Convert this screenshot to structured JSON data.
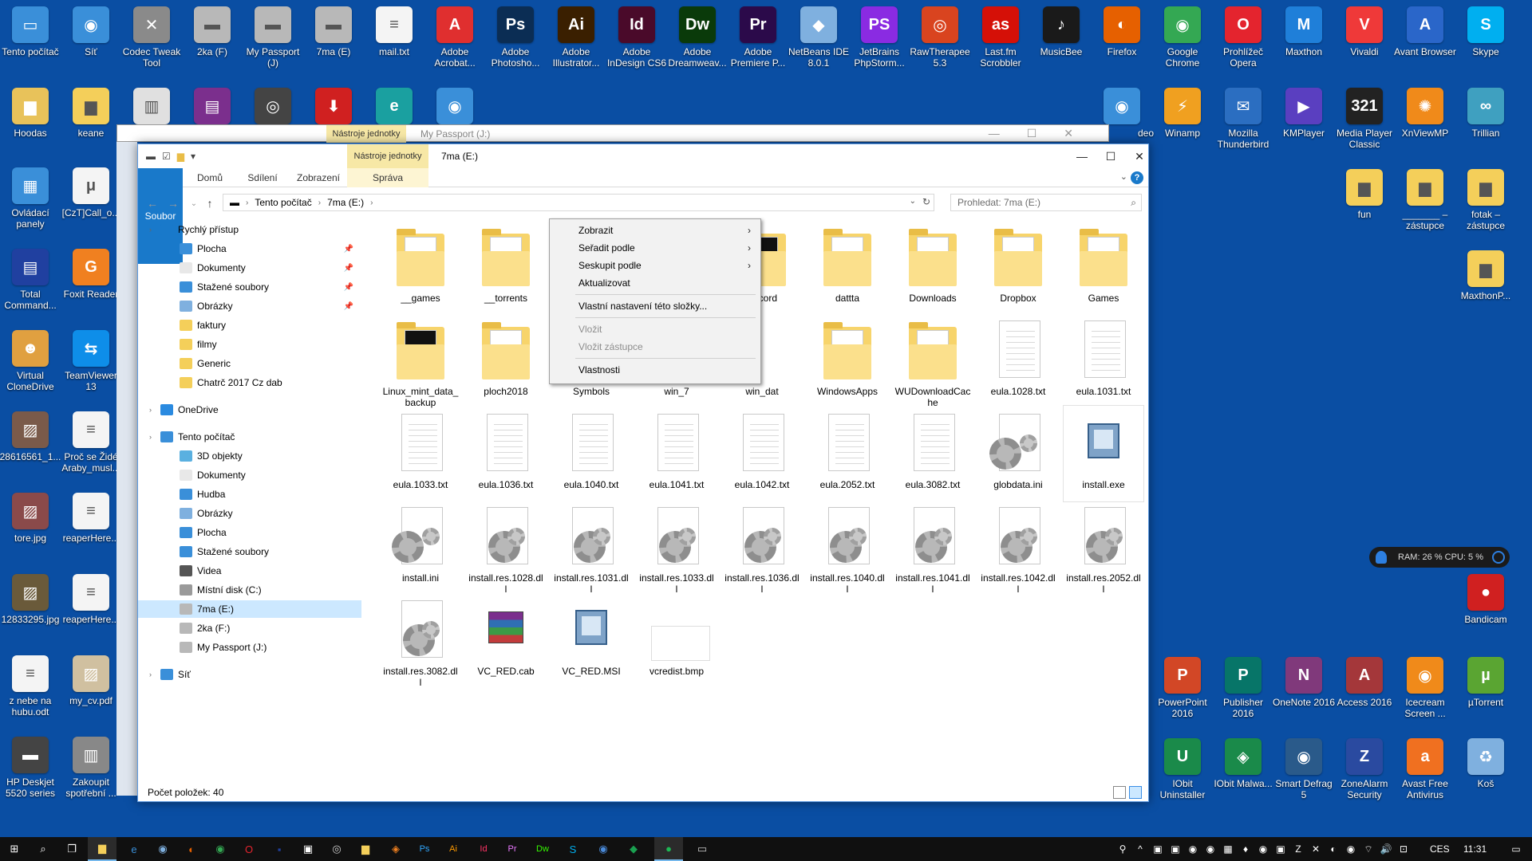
{
  "desktop": {
    "icons_top": [
      {
        "label": "Tento počítač",
        "color": "#3a8fd9",
        "glyph": "▭"
      },
      {
        "label": "Síť",
        "color": "#3a8fd9",
        "glyph": "◉"
      },
      {
        "label": "Codec Tweak Tool",
        "color": "#8a8a8a",
        "glyph": "✕"
      },
      {
        "label": "2ka (F)",
        "color": "#b8b8b8",
        "glyph": "▬"
      },
      {
        "label": "My Passport (J)",
        "color": "#b8b8b8",
        "glyph": "▬"
      },
      {
        "label": "7ma (E)",
        "color": "#b8b8b8",
        "glyph": "▬"
      },
      {
        "label": "mail.txt",
        "color": "#f4f4f4",
        "glyph": "≡"
      },
      {
        "label": "Adobe Acrobat...",
        "color": "#e02f2f",
        "glyph": "A"
      },
      {
        "label": "Adobe Photosho...",
        "color": "#0b2d54",
        "glyph": "Ps"
      },
      {
        "label": "Adobe Illustrator...",
        "color": "#3a1f00",
        "glyph": "Ai"
      },
      {
        "label": "Adobe InDesign CS6",
        "color": "#4a0a2a",
        "glyph": "Id"
      },
      {
        "label": "Adobe Dreamweav...",
        "color": "#0a3a0a",
        "glyph": "Dw"
      },
      {
        "label": "Adobe Premiere P...",
        "color": "#2b0a4a",
        "glyph": "Pr"
      },
      {
        "label": "NetBeans IDE 8.0.1",
        "color": "#7fb0df",
        "glyph": "◆"
      },
      {
        "label": "JetBrains PhpStorm...",
        "color": "#8a2be2",
        "glyph": "PS"
      },
      {
        "label": "RawTherapee 5.3",
        "color": "#d9441f",
        "glyph": "◎"
      },
      {
        "label": "Last.fm Scrobbler",
        "color": "#d51007",
        "glyph": "as"
      },
      {
        "label": "MusicBee",
        "color": "#1a1a1a",
        "glyph": "♪"
      },
      {
        "label": "Firefox",
        "color": "#e66000",
        "glyph": "◐"
      },
      {
        "label": "Google Chrome",
        "color": "#34a853",
        "glyph": "◉"
      },
      {
        "label": "Prohlížeč Opera",
        "color": "#e4242e",
        "glyph": "O"
      },
      {
        "label": "Maxthon",
        "color": "#1f7fd9",
        "glyph": "M"
      },
      {
        "label": "Vivaldi",
        "color": "#ef3939",
        "glyph": "V"
      },
      {
        "label": "Avant Browser",
        "color": "#2a66c9",
        "glyph": "A"
      },
      {
        "label": "Skype",
        "color": "#00aff0",
        "glyph": "S"
      }
    ],
    "icons_row2_left": [
      {
        "label": "Hoodas",
        "color": "#e8c25a",
        "glyph": "▆"
      },
      {
        "label": "keane",
        "color": "#f4cf5a",
        "glyph": "▆"
      }
    ],
    "icons_row2_right": [
      {
        "label": "Winamp",
        "color": "#f0a020",
        "glyph": "⚡"
      },
      {
        "label": "Mozilla Thunderbird",
        "color": "#2b6ec1",
        "glyph": "✉"
      },
      {
        "label": "KMPlayer",
        "color": "#5a3fc0",
        "glyph": "▶"
      },
      {
        "label": "Media Player Classic",
        "color": "#222222",
        "glyph": "321"
      },
      {
        "label": "XnViewMP",
        "color": "#f08a1a",
        "glyph": "✺"
      },
      {
        "label": "Trillian",
        "color": "#3fa0c0",
        "glyph": "∞"
      }
    ],
    "icons_left_col1": [
      {
        "label": "Ovládací panely",
        "color": "#3a8fd9",
        "glyph": "▦"
      },
      {
        "label": "Total Command...",
        "color": "#2040a0",
        "glyph": "▤"
      },
      {
        "label": "Virtual CloneDrive",
        "color": "#e0a040",
        "glyph": "☻"
      },
      {
        "label": "28616561_1...",
        "color": "#7a5a4a",
        "glyph": "▨"
      },
      {
        "label": "tore.jpg",
        "color": "#8a4a4a",
        "glyph": "▨"
      },
      {
        "label": "12833295.jpg",
        "color": "#6a5a3a",
        "glyph": "▨"
      },
      {
        "label": "z nebe na hubu.odt",
        "color": "#f4f4f4",
        "glyph": "≡"
      },
      {
        "label": "HP Deskjet 5520 series",
        "color": "#444444",
        "glyph": "▬"
      }
    ],
    "icons_left_col2": [
      {
        "label": "[CzT]Call_o...",
        "color": "#f4f4f4",
        "glyph": "μ"
      },
      {
        "label": "Foxit Reader",
        "color": "#f08020",
        "glyph": "G"
      },
      {
        "label": "TeamViewer 13",
        "color": "#0e8ee9",
        "glyph": "⇆"
      },
      {
        "label": "Proč se Židé Araby_musl...",
        "color": "#f4f4f4",
        "glyph": "≡"
      },
      {
        "label": "reaperHere...",
        "color": "#f4f4f4",
        "glyph": "≡"
      },
      {
        "label": "reaperHere...",
        "color": "#f4f4f4",
        "glyph": "≡"
      },
      {
        "label": "my_cv.pdf",
        "color": "#d0c0a0",
        "glyph": "▨"
      },
      {
        "label": "Zakoupit spotřební ...",
        "color": "#888888",
        "glyph": "▥"
      }
    ],
    "icons_right_mid": [
      {
        "label": "fun",
        "color": "#f4cf5a",
        "glyph": "▆"
      },
      {
        "label": "_______ – zástupce",
        "color": "#f4cf5a",
        "glyph": "▆"
      },
      {
        "label": "fotak – zástupce",
        "color": "#f4cf5a",
        "glyph": "▆"
      },
      {
        "label": "MaxthonP...",
        "color": "#f4cf5a",
        "glyph": "▆"
      }
    ],
    "bandicam": {
      "label": "Bandicam",
      "color": "#d02020",
      "glyph": "●"
    },
    "icons_bottom_right_row1": [
      {
        "label": "PowerPoint 2016",
        "color": "#d24726",
        "glyph": "P"
      },
      {
        "label": "Publisher 2016",
        "color": "#077568",
        "glyph": "P"
      },
      {
        "label": "OneNote 2016",
        "color": "#80397b",
        "glyph": "N"
      },
      {
        "label": "Access 2016",
        "color": "#a4373a",
        "glyph": "A"
      },
      {
        "label": "Icecream Screen ...",
        "color": "#f08a1a",
        "glyph": "◉"
      },
      {
        "label": "µTorrent",
        "color": "#5aa532",
        "glyph": "µ"
      }
    ],
    "icons_bottom_right_row2": [
      {
        "label": "IObit Uninstaller",
        "color": "#1a8a4a",
        "glyph": "U"
      },
      {
        "label": "IObit Malwa...",
        "color": "#1a8a4a",
        "glyph": "◈"
      },
      {
        "label": "Smart Defrag 5",
        "color": "#2a5a8a",
        "glyph": "◉"
      },
      {
        "label": "ZoneAlarm Security",
        "color": "#2a4aa0",
        "glyph": "Z"
      },
      {
        "label": "Avast Free Antivirus",
        "color": "#f07020",
        "glyph": "a"
      },
      {
        "label": "Koš",
        "color": "#7fb0df",
        "glyph": "♻"
      }
    ],
    "icons_misc_row2": [
      {
        "color": "#e0e0e0",
        "glyph": "▥"
      },
      {
        "color": "#7b2f8d",
        "glyph": "▤"
      },
      {
        "color": "#444444",
        "glyph": "◎"
      },
      {
        "color": "#d02020",
        "glyph": "⬇"
      },
      {
        "color": "#1aa0a0",
        "glyph": "e"
      },
      {
        "color": "#3a8fd9",
        "glyph": "◉"
      }
    ],
    "partial_label": "deo"
  },
  "back_window": {
    "title": "My Passport (J:)",
    "tools_tab": "Nástroje jednotky"
  },
  "window": {
    "title": "7ma (E:)",
    "tools_tab": "Nástroje jednotky",
    "controls": {
      "minimize": "—",
      "maximize": "☐",
      "close": "✕"
    },
    "ribbon_tabs": [
      "Soubor",
      "Domů",
      "Sdílení",
      "Zobrazení",
      "Správa"
    ],
    "address": {
      "root": "Tento počítač",
      "current": "7ma (E:)"
    },
    "search_placeholder": "Prohledat: 7ma (E:)",
    "status": "Počet položek: 40"
  },
  "navigation": {
    "quick_access": "Rychlý přístup",
    "quick_items": [
      {
        "label": "Plocha",
        "color": "#3a8fd9",
        "pinned": true
      },
      {
        "label": "Dokumenty",
        "color": "#e8e8e8",
        "pinned": true
      },
      {
        "label": "Stažené soubory",
        "color": "#3a8fd9",
        "pinned": true
      },
      {
        "label": "Obrázky",
        "color": "#7fb0df",
        "pinned": true
      },
      {
        "label": "faktury",
        "color": "#f4cf5a",
        "pinned": false
      },
      {
        "label": "filmy",
        "color": "#f4cf5a",
        "pinned": false
      },
      {
        "label": "Generic",
        "color": "#f4cf5a",
        "pinned": false
      },
      {
        "label": "Chatrč 2017 Cz dab",
        "color": "#f4cf5a",
        "pinned": false
      }
    ],
    "onedrive": "OneDrive",
    "this_pc": "Tento počítač",
    "pc_items": [
      {
        "label": "3D objekty",
        "color": "#5ab0e0"
      },
      {
        "label": "Dokumenty",
        "color": "#e8e8e8"
      },
      {
        "label": "Hudba",
        "color": "#3a8fd9"
      },
      {
        "label": "Obrázky",
        "color": "#7fb0df"
      },
      {
        "label": "Plocha",
        "color": "#3a8fd9"
      },
      {
        "label": "Stažené soubory",
        "color": "#3a8fd9"
      },
      {
        "label": "Videa",
        "color": "#555555"
      },
      {
        "label": "Místní disk (C:)",
        "color": "#9a9a9a"
      },
      {
        "label": "7ma (E:)",
        "color": "#b8b8b8",
        "selected": true
      },
      {
        "label": "2ka (F:)",
        "color": "#b8b8b8"
      },
      {
        "label": "My Passport (J:)",
        "color": "#b8b8b8"
      }
    ],
    "network": "Síť"
  },
  "files": [
    {
      "name": "__games",
      "type": "folder"
    },
    {
      "name": "__torrents",
      "type": "folder"
    },
    {
      "name": "",
      "type": "hidden"
    },
    {
      "name": "",
      "type": "hidden"
    },
    {
      "name": "-record",
      "type": "folder-dark"
    },
    {
      "name": "dattta",
      "type": "folder"
    },
    {
      "name": "Downloads",
      "type": "folder"
    },
    {
      "name": "Dropbox",
      "type": "folder"
    },
    {
      "name": "Games",
      "type": "folder"
    },
    {
      "name": "Linux_mint_data_backup",
      "type": "folder-dark"
    },
    {
      "name": "ploch2018",
      "type": "folder"
    },
    {
      "name": "Symbols",
      "type": "hidden"
    },
    {
      "name": "win_7",
      "type": "hidden"
    },
    {
      "name": "win_dat",
      "type": "hidden"
    },
    {
      "name": "WindowsApps",
      "type": "folder"
    },
    {
      "name": "WUDownloadCache",
      "type": "folder"
    },
    {
      "name": "eula.1028.txt",
      "type": "doc"
    },
    {
      "name": "eula.1031.txt",
      "type": "doc"
    },
    {
      "name": "eula.1033.txt",
      "type": "doc"
    },
    {
      "name": "eula.1036.txt",
      "type": "doc"
    },
    {
      "name": "eula.1040.txt",
      "type": "doc"
    },
    {
      "name": "eula.1041.txt",
      "type": "doc"
    },
    {
      "name": "eula.1042.txt",
      "type": "doc"
    },
    {
      "name": "eula.2052.txt",
      "type": "doc"
    },
    {
      "name": "eula.3082.txt",
      "type": "doc"
    },
    {
      "name": "globdata.ini",
      "type": "ini"
    },
    {
      "name": "install.exe",
      "type": "exe"
    },
    {
      "name": "install.ini",
      "type": "ini"
    },
    {
      "name": "install.res.1028.dll",
      "type": "dll"
    },
    {
      "name": "install.res.1031.dll",
      "type": "dll"
    },
    {
      "name": "install.res.1033.dll",
      "type": "dll"
    },
    {
      "name": "install.res.1036.dll",
      "type": "dll"
    },
    {
      "name": "install.res.1040.dll",
      "type": "dll"
    },
    {
      "name": "install.res.1041.dll",
      "type": "dll"
    },
    {
      "name": "install.res.1042.dll",
      "type": "dll"
    },
    {
      "name": "install.res.2052.dll",
      "type": "dll"
    },
    {
      "name": "install.res.3082.dll",
      "type": "dll"
    },
    {
      "name": "VC_RED.cab",
      "type": "rar"
    },
    {
      "name": "VC_RED.MSI",
      "type": "exe"
    },
    {
      "name": "vcredist.bmp",
      "type": "bmp"
    }
  ],
  "context_menu": {
    "items": [
      {
        "label": "Zobrazit",
        "submenu": true
      },
      {
        "label": "Seřadit podle",
        "submenu": true
      },
      {
        "label": "Seskupit podle",
        "submenu": true
      },
      {
        "label": "Aktualizovat"
      },
      {
        "separator": true
      },
      {
        "label": "Vlastní nastavení této složky..."
      },
      {
        "separator": true
      },
      {
        "label": "Vložit",
        "disabled": true
      },
      {
        "label": "Vložit zástupce",
        "disabled": true
      },
      {
        "separator": true
      },
      {
        "label": "Vlastnosti"
      }
    ]
  },
  "widget": {
    "text": "RAM: 26 %  CPU: 5 %"
  },
  "taskbar": {
    "pinned": [
      {
        "name": "start",
        "glyph": "⊞",
        "color": "#ffffff"
      },
      {
        "name": "search",
        "glyph": "⌕",
        "color": "#ffffff"
      },
      {
        "name": "task-view",
        "glyph": "❐",
        "color": "#ffffff"
      },
      {
        "name": "explorer",
        "glyph": "▆",
        "color": "#f4cf5a",
        "active": true
      },
      {
        "name": "edge",
        "glyph": "e",
        "color": "#3a8fd9"
      },
      {
        "name": "app",
        "glyph": "◉",
        "color": "#7fb0df"
      },
      {
        "name": "firefox",
        "glyph": "◐",
        "color": "#e66000"
      },
      {
        "name": "chrome",
        "glyph": "◉",
        "color": "#34a853"
      },
      {
        "name": "opera",
        "glyph": "O",
        "color": "#e4242e"
      },
      {
        "name": "save",
        "glyph": "▪",
        "color": "#2040a0"
      },
      {
        "name": "store",
        "glyph": "▣",
        "color": "#ffffff"
      },
      {
        "name": "app2",
        "glyph": "◎",
        "color": "#cccccc"
      },
      {
        "name": "folder2",
        "glyph": "▆",
        "color": "#f4cf5a"
      },
      {
        "name": "app3",
        "glyph": "◈",
        "color": "#f08020"
      },
      {
        "name": "photoshop",
        "glyph": "Ps",
        "color": "#31a8ff"
      },
      {
        "name": "illustrator",
        "glyph": "Ai",
        "color": "#ff9a00"
      },
      {
        "name": "indesign",
        "glyph": "Id",
        "color": "#ff3366"
      },
      {
        "name": "premiere",
        "glyph": "Pr",
        "color": "#ea77ff"
      },
      {
        "name": "dreamweaver",
        "glyph": "Dw",
        "color": "#35fa00"
      },
      {
        "name": "skype",
        "glyph": "S",
        "color": "#00aff0"
      },
      {
        "name": "app4",
        "glyph": "◉",
        "color": "#4a8ad9"
      },
      {
        "name": "app5",
        "glyph": "◆",
        "color": "#1aa050"
      },
      {
        "name": "spotify",
        "glyph": "●",
        "color": "#1db954",
        "active": true
      },
      {
        "name": "app6",
        "glyph": "▭",
        "color": "#cccccc"
      }
    ],
    "tray_icons": [
      "⚲",
      "^",
      "▣",
      "▣",
      "◉",
      "◉",
      "▦",
      "♦",
      "◉",
      "▣",
      "Z",
      "✕",
      "◐",
      "◉",
      "⌔",
      "🔊",
      "⊡"
    ],
    "language": "CES",
    "time": "11:31"
  }
}
